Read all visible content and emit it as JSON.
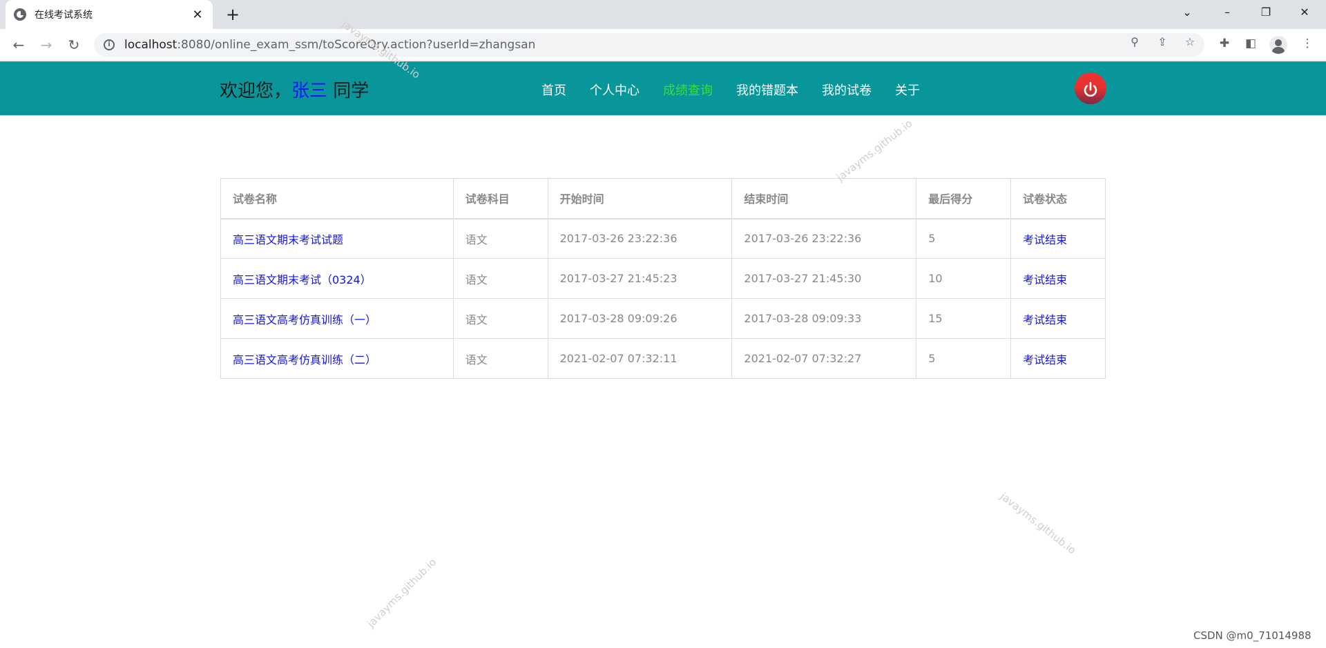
{
  "browser": {
    "tab_title": "在线考试系统",
    "tab_close": "✕",
    "new_tab": "+",
    "url_host": "localhost",
    "url_path": ":8080/online_exam_ssm/toScoreQry.action?userId=zhangsan",
    "window_controls": [
      "⌄",
      "–",
      "❐",
      "✕"
    ]
  },
  "header": {
    "welcome_prefix": "欢迎您，",
    "username": "张三",
    "welcome_suffix": " 同学",
    "nav": [
      {
        "label": "首页",
        "active": false
      },
      {
        "label": "个人中心",
        "active": false
      },
      {
        "label": "成绩查询",
        "active": true
      },
      {
        "label": "我的错题本",
        "active": false
      },
      {
        "label": "我的试卷",
        "active": false
      },
      {
        "label": "关于",
        "active": false
      }
    ]
  },
  "table": {
    "headers": [
      "试卷名称",
      "试卷科目",
      "开始时间",
      "结束时间",
      "最后得分",
      "试卷状态"
    ],
    "rows": [
      [
        "高三语文期末考试试题",
        "语文",
        "2017-03-26 23:22:36",
        "2017-03-26 23:22:36",
        "5",
        "考试结束"
      ],
      [
        "高三语文期末考试（0324）",
        "语文",
        "2017-03-27 21:45:23",
        "2017-03-27 21:45:30",
        "10",
        "考试结束"
      ],
      [
        "高三语文高考仿真训练（一）",
        "语文",
        "2017-03-28 09:09:26",
        "2017-03-28 09:09:33",
        "15",
        "考试结束"
      ],
      [
        "高三语文高考仿真训练（二）",
        "语文",
        "2021-02-07 07:32:11",
        "2021-02-07 07:32:27",
        "5",
        "考试结束"
      ]
    ]
  },
  "watermark": "javayms.github.io",
  "footer_credit": "CSDN @m0_71014988",
  "colors": {
    "header_bg": "#09969a",
    "active_nav": "#3cdc3c",
    "link": "#1515e0"
  }
}
